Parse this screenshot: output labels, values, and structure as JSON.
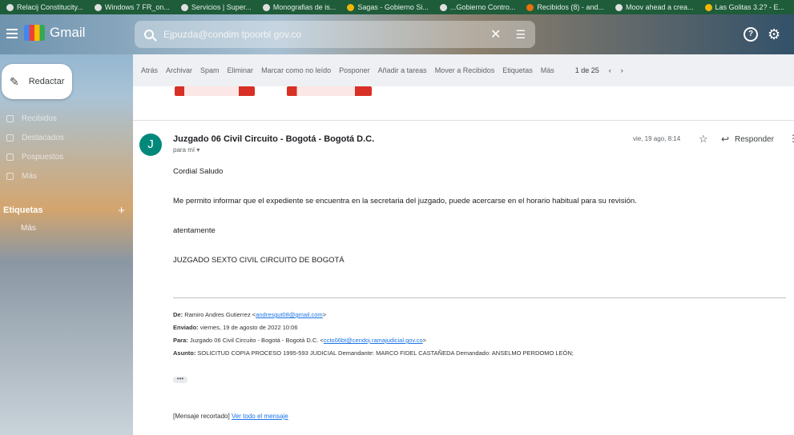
{
  "bookmarks": [
    {
      "label": "Relacij Constitucity..."
    },
    {
      "label": "Windows 7 FR_on..."
    },
    {
      "label": "Servicios | Super..."
    },
    {
      "label": "Monografias de is..."
    },
    {
      "label": "Sagas - Gobierno Si..."
    },
    {
      "label": "...Gobierno Contro..."
    },
    {
      "label": "Recibidos (8) - and..."
    },
    {
      "label": "Moov ahead a crea..."
    },
    {
      "label": "Las Golitas 3.2? - E..."
    }
  ],
  "header": {
    "app_name": "Gmail",
    "search_value": "Ejpuzda@condim tpoorbl gov.co",
    "help_label": "?"
  },
  "sidebar": {
    "compose_label": "Redactar",
    "items": [
      {
        "label": "Recibidos"
      },
      {
        "label": "Destacados"
      },
      {
        "label": "Pospuestos"
      },
      {
        "label": "Más"
      }
    ],
    "labels_heading": "Etiquetas",
    "labels_add": "+",
    "label_item": "Más"
  },
  "toolbar": {
    "items": [
      "Atrás",
      "Archivar",
      "Spam",
      "Eliminar",
      "Marcar como no leído",
      "Posponer",
      "Añadir a tareas",
      "Mover a Recibidos",
      "Etiquetas",
      "Más"
    ],
    "pager": "1 de 25",
    "prev": "‹",
    "next": "›"
  },
  "email": {
    "avatar_letter": "J",
    "sender": "Juzgado 06 Civil Circuito - Bogotá - Bogotá D.C.",
    "to_me": "para mí ▾",
    "date": "vie, 19 ago, 8:14",
    "reply_label": "Responder",
    "greeting": "Cordial Saludo",
    "body": "Me permito informar que el expediente se encuentra en la secretaria del juzgado, puede acercarse en el horario habitual para su revisión.",
    "closing": "atentamente",
    "signature": "JUZGADO SEXTO CIVIL CIRCUITO DE BOGOTÁ",
    "quoted": {
      "de_label": "De:",
      "de_value": "Ramiro Andres Gutierrez <",
      "de_email": "andresgut08@gmail.com",
      "de_close": ">",
      "enviado_label": "Enviado:",
      "enviado_value": "viernes, 19 de agosto de 2022 10:06",
      "para_label": "Para:",
      "para_value": "Juzgado 06 Civil Circuito - Bogotá - Bogotá D.C. <",
      "para_email": "ccto06bt@cendoj.ramajudicial.gov.co",
      "para_close": ">",
      "asunto_label": "Asunto:",
      "asunto_value": "SOLICITUD COPIA PROCESO 1995-593 JUDICIAL Demandante: MARCO FIDEL CASTAÑEDA Demandado: ANSELMO PERDOMO LEÓN;"
    },
    "ellipsis": "•••",
    "footer_label": "[Mensaje recortado]",
    "footer_link": "Ver todo el mensaje"
  }
}
